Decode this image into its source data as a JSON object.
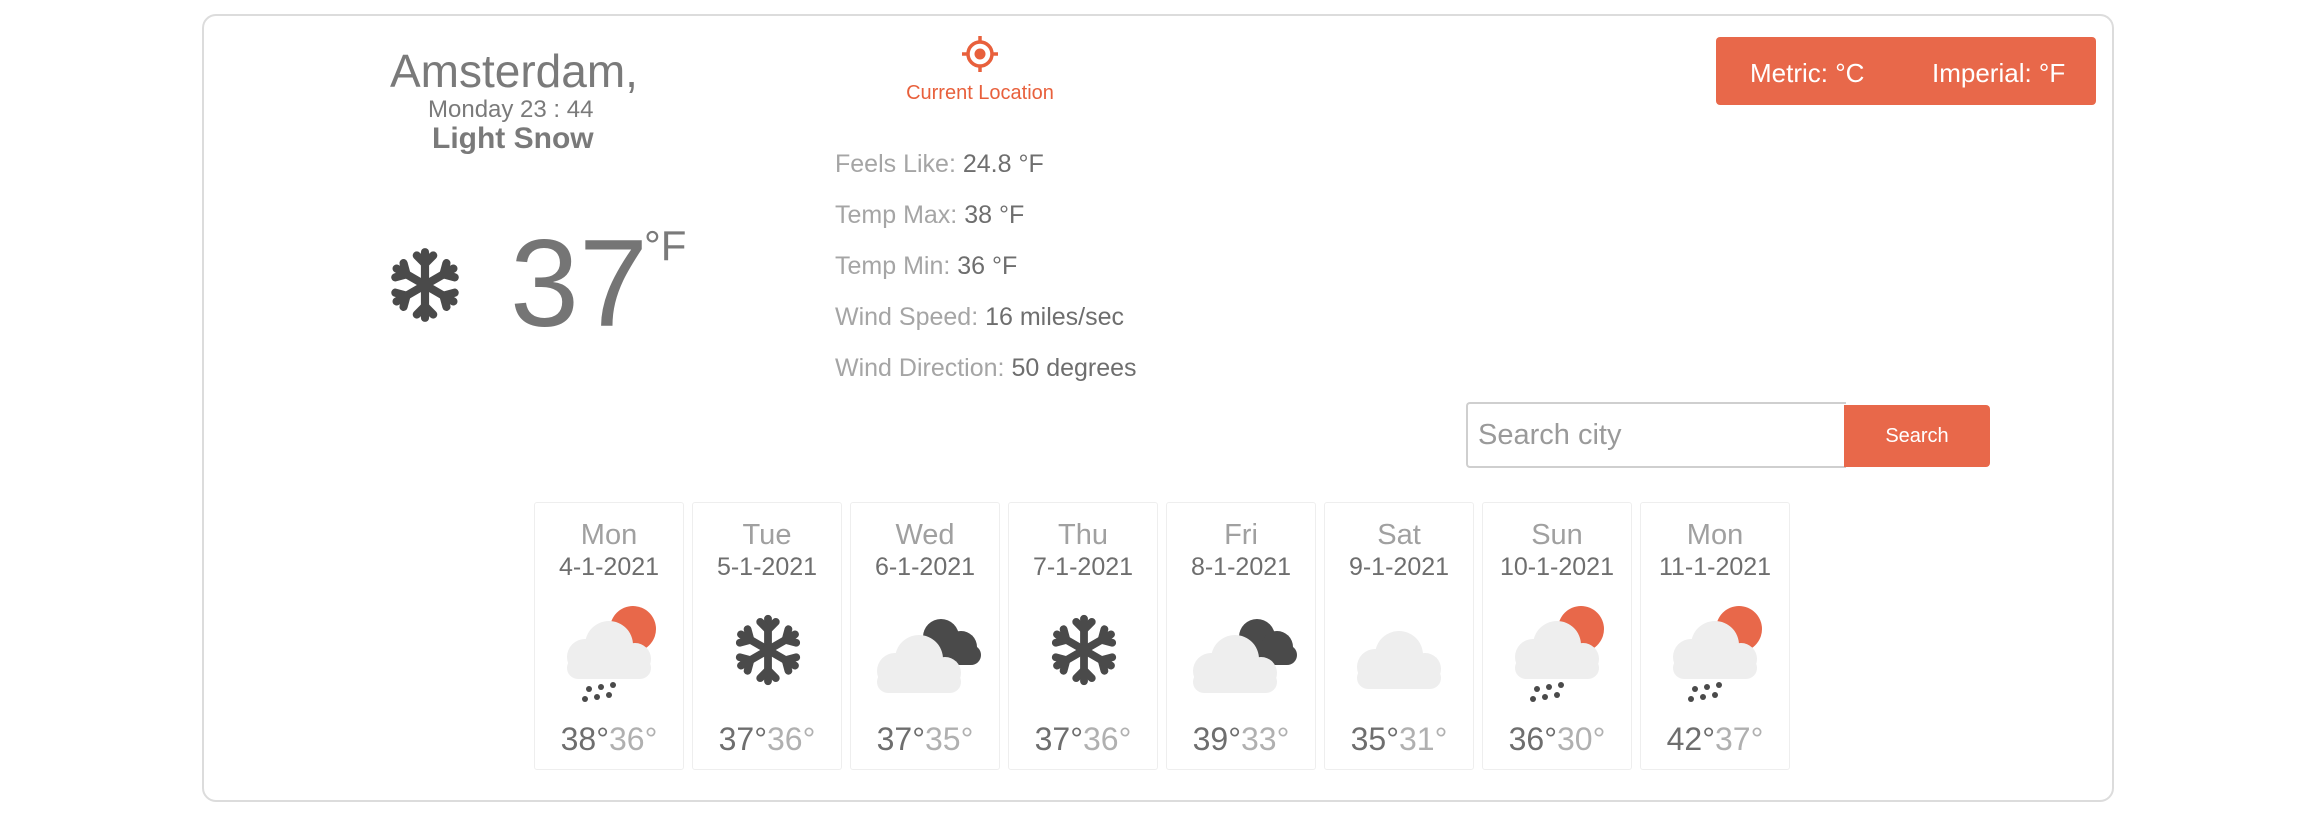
{
  "current": {
    "city": "Amsterdam,",
    "datetime": "Monday 23 : 44",
    "condition": "Light Snow",
    "icon": "snowflake-icon",
    "temp": "37",
    "unit": "°F"
  },
  "location_button": {
    "label": "Current Location",
    "icon": "crosshair-icon"
  },
  "details": [
    {
      "label": "Feels Like:",
      "value": "24.8 °F"
    },
    {
      "label": "Temp Max:",
      "value": "38 °F"
    },
    {
      "label": "Temp Min:",
      "value": "36 °F"
    },
    {
      "label": "Wind Speed:",
      "value": "16 miles/sec"
    },
    {
      "label": "Wind Direction:",
      "value": "50 degrees"
    }
  ],
  "units": {
    "metric": "Metric: °C",
    "imperial": "Imperial: °F"
  },
  "search": {
    "placeholder": "Search city",
    "button": "Search"
  },
  "forecast": [
    {
      "day": "Mon",
      "date": "4-1-2021",
      "icon": "sun-cloud-rain",
      "max": "38°",
      "min": "36°"
    },
    {
      "day": "Tue",
      "date": "5-1-2021",
      "icon": "snowflake",
      "max": "37°",
      "min": "36°"
    },
    {
      "day": "Wed",
      "date": "6-1-2021",
      "icon": "dark-clouds",
      "max": "37°",
      "min": "35°"
    },
    {
      "day": "Thu",
      "date": "7-1-2021",
      "icon": "snowflake",
      "max": "37°",
      "min": "36°"
    },
    {
      "day": "Fri",
      "date": "8-1-2021",
      "icon": "dark-clouds",
      "max": "39°",
      "min": "33°"
    },
    {
      "day": "Sat",
      "date": "9-1-2021",
      "icon": "cloud",
      "max": "35°",
      "min": "31°"
    },
    {
      "day": "Sun",
      "date": "10-1-2021",
      "icon": "sun-cloud-rain",
      "max": "36°",
      "min": "30°"
    },
    {
      "day": "Mon",
      "date": "11-1-2021",
      "icon": "sun-cloud-rain",
      "max": "42°",
      "min": "37°"
    }
  ],
  "colors": {
    "accent": "#e8684a",
    "text": "#7a7a7a",
    "muted": "#a5a5a5",
    "icon_dark": "#4a4a4a",
    "cloud": "#eeeeee"
  }
}
